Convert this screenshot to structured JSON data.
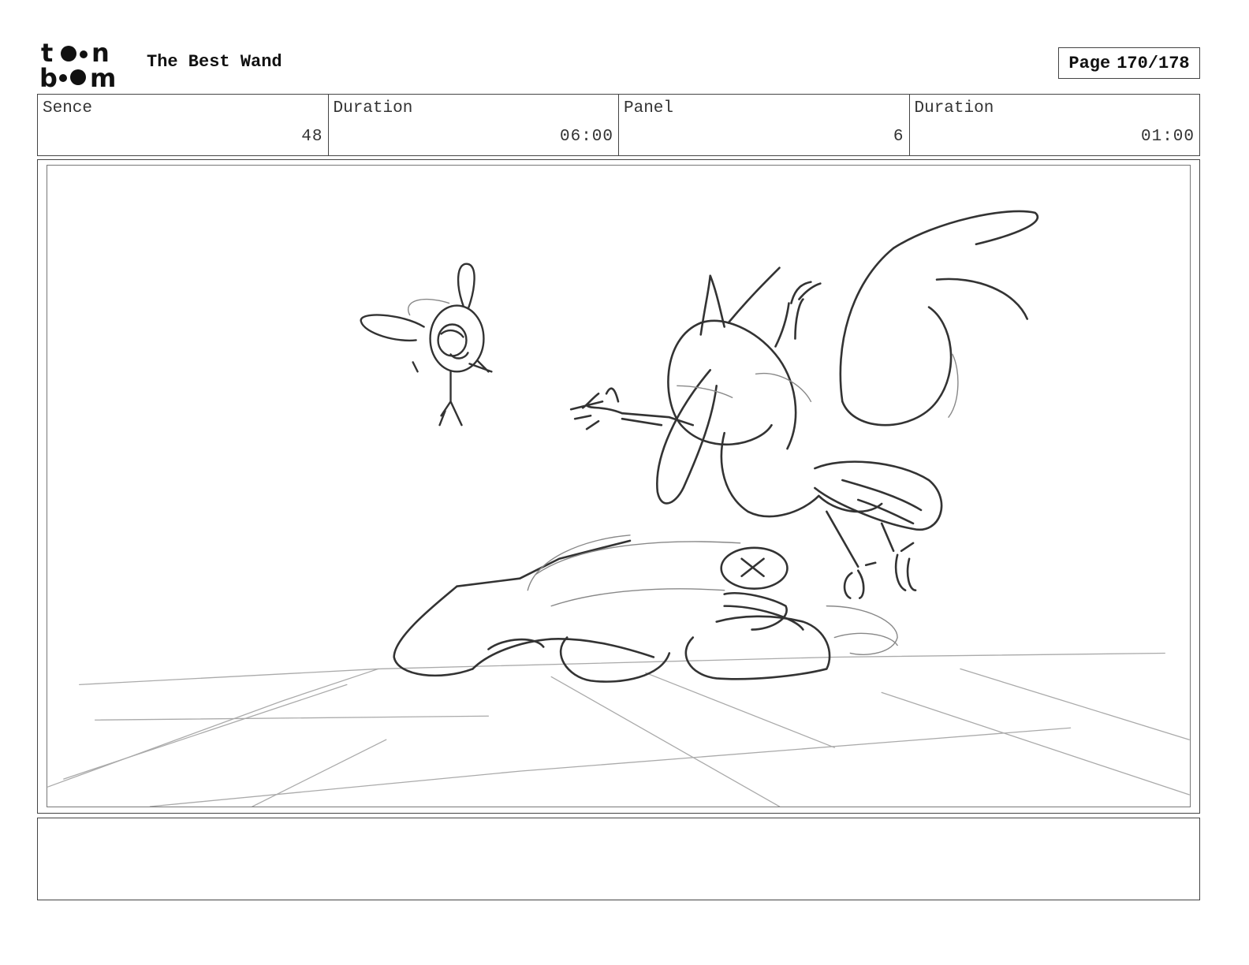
{
  "header": {
    "logo_text": "toon boom",
    "title": "The Best Wand",
    "page_label": "Page",
    "page_value": "170/178"
  },
  "info": {
    "scene_label": "Sence",
    "scene_value": "48",
    "scene_duration_label": "Duration",
    "scene_duration_value": "06:00",
    "panel_label": "Panel",
    "panel_value": "6",
    "panel_duration_label": "Duration",
    "panel_duration_value": "01:00"
  },
  "notes": {
    "text": ""
  }
}
